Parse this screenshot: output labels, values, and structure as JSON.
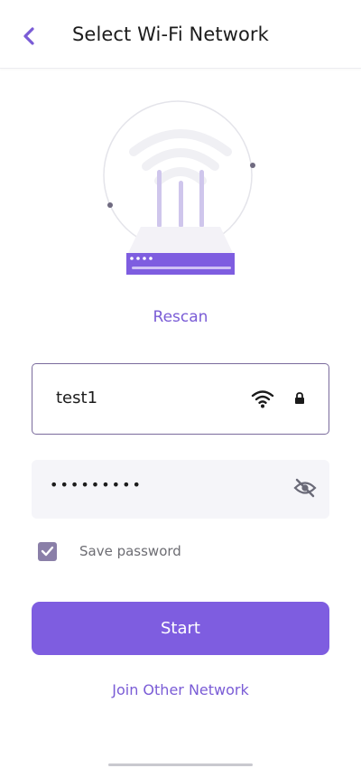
{
  "header": {
    "title": "Select Wi-Fi Network",
    "back_icon": "chevron-left-icon"
  },
  "illustration": {
    "icon": "router-illustration",
    "accent_color": "#7e5de0"
  },
  "rescan_label": "Rescan",
  "network": {
    "ssid": "test1",
    "signal_icon": "wifi-icon",
    "security_icon": "lock-icon"
  },
  "password": {
    "value_masked": "•••••••••",
    "visibility_icon": "eye-off-icon"
  },
  "save_password": {
    "label": "Save password",
    "checked": true
  },
  "start_label": "Start",
  "join_other_label": "Join Other Network",
  "colors": {
    "accent": "#7e5de0",
    "link": "#7a5cd6",
    "checkbox": "#8a7fa8"
  }
}
